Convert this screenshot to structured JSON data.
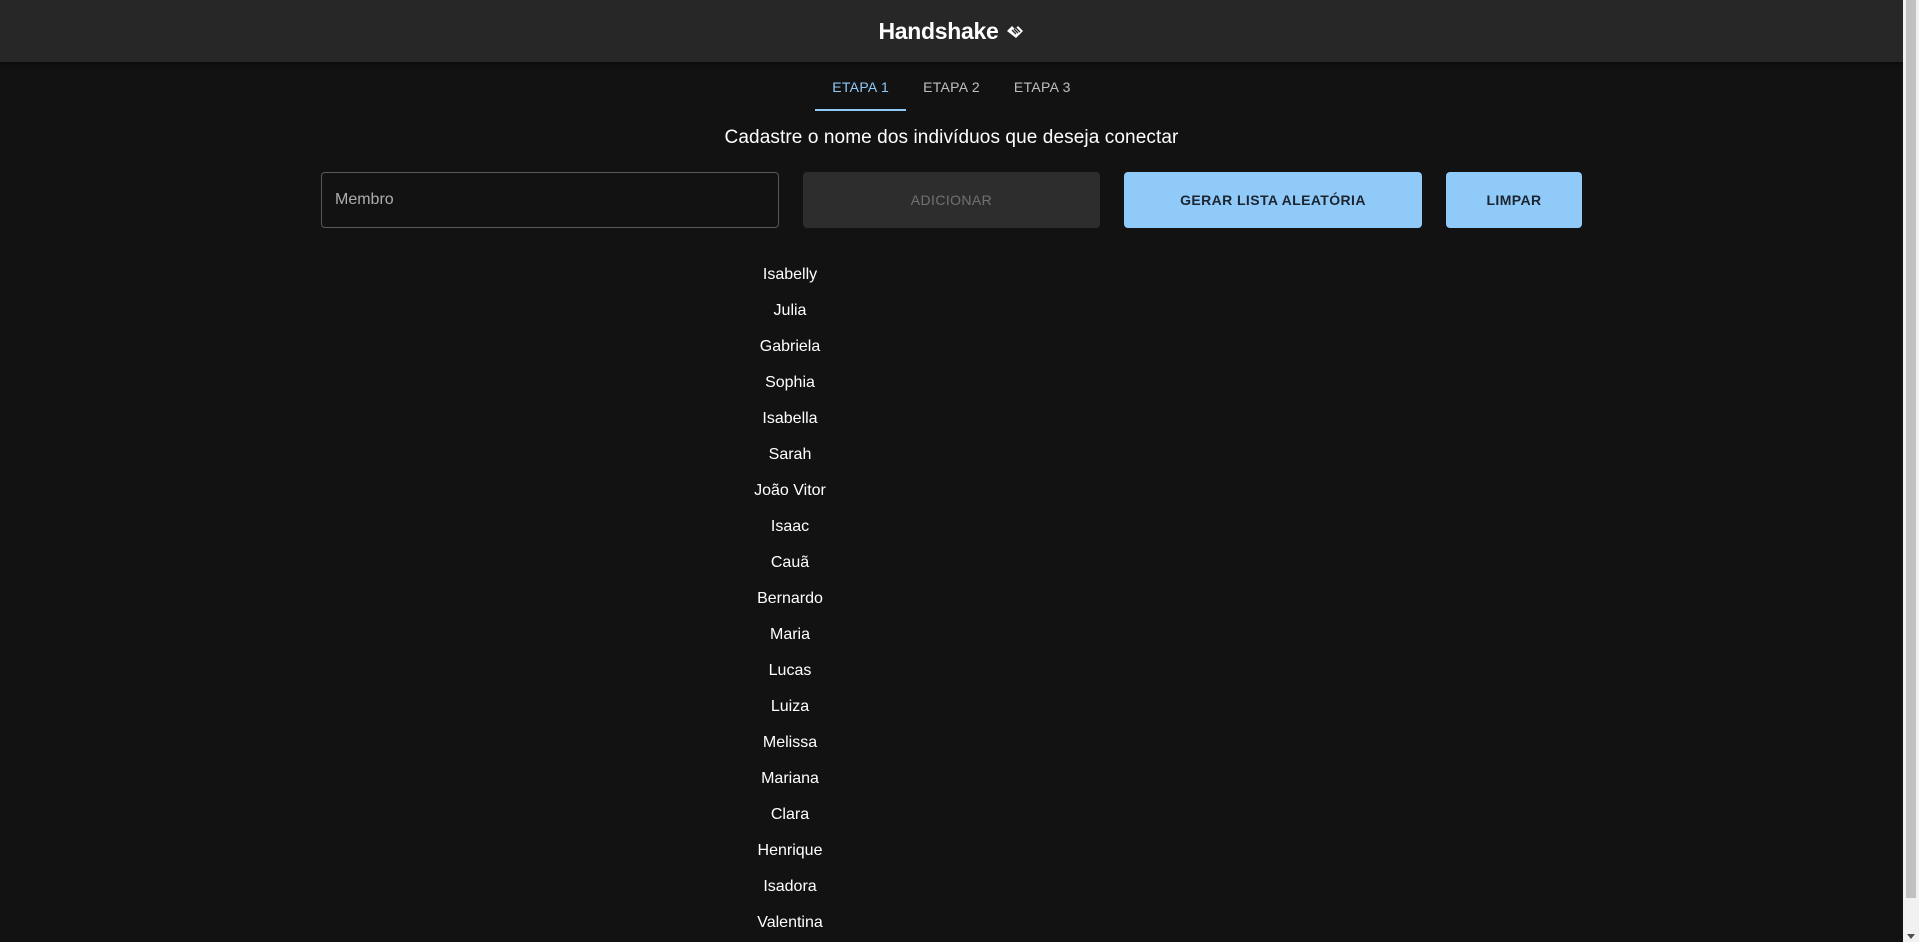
{
  "appbar": {
    "title": "Handshake"
  },
  "tabs": [
    {
      "label": "ETAPA 1",
      "active": true
    },
    {
      "label": "ETAPA 2",
      "active": false
    },
    {
      "label": "ETAPA 3",
      "active": false
    }
  ],
  "main": {
    "subtitle": "Cadastre o nome dos indivíduos que deseja conectar",
    "member_input": {
      "value": "",
      "placeholder": "Membro"
    },
    "add_button_label": "ADICIONAR",
    "random_button_label": "GERAR LISTA ALEATÓRIA",
    "clear_button_label": "LIMPAR",
    "members": [
      "Isabelly",
      "Julia",
      "Gabriela",
      "Sophia",
      "Isabella",
      "Sarah",
      "João Vitor",
      "Isaac",
      "Cauã",
      "Bernardo",
      "Maria",
      "Lucas",
      "Luiza",
      "Melissa",
      "Mariana",
      "Clara",
      "Henrique",
      "Isadora",
      "Valentina"
    ]
  },
  "colors": {
    "background": "#121212",
    "appbar": "#272727",
    "accent": "#90caf9"
  },
  "icons": {
    "brand": "handshake-icon"
  }
}
